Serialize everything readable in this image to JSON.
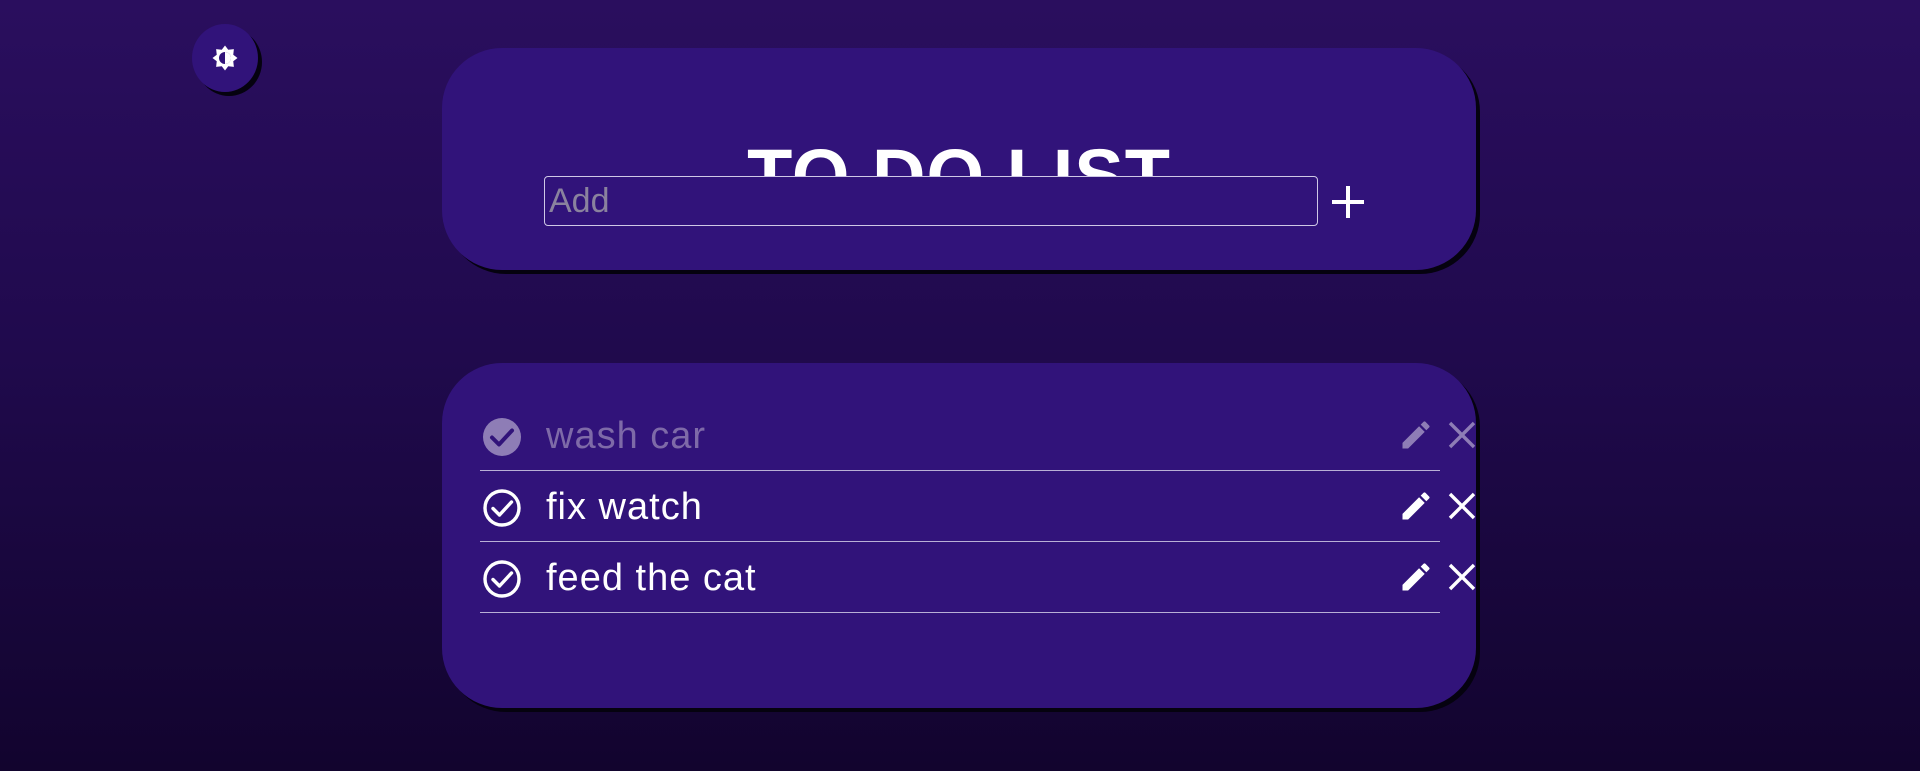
{
  "theme_toggle": {
    "icon": "brightness-contrast-icon"
  },
  "header": {
    "title": "TO DO LIST",
    "input_placeholder": "Add",
    "input_value": "",
    "add_icon": "plus-icon"
  },
  "todos": [
    {
      "text": "wash car",
      "completed": true
    },
    {
      "text": "fix watch",
      "completed": false
    },
    {
      "text": "feed the cat",
      "completed": false
    }
  ],
  "colors": {
    "background_top": "#2a0e5e",
    "background_bottom": "#12042e",
    "card": "#31137a",
    "text": "#ffffff",
    "completed_text": "#7e6aa8",
    "placeholder": "#8a829e"
  }
}
